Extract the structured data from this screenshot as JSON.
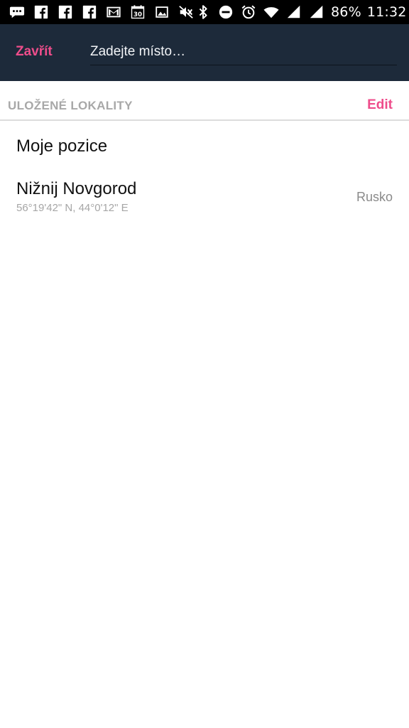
{
  "status_bar": {
    "battery_percent": "86%",
    "time": "11:32",
    "notification_icons": [
      "chat-icon",
      "facebook-icon",
      "facebook-icon",
      "facebook-icon",
      "gmail-icon",
      "calendar-icon",
      "gallery-icon",
      "mute-icon"
    ],
    "system_icons": [
      "bluetooth-icon",
      "do-not-disturb-icon",
      "alarm-icon",
      "wifi-icon",
      "signal-icon",
      "signal-icon"
    ],
    "calendar_day": "30"
  },
  "header": {
    "close_label": "Zavřít",
    "search_placeholder": "Zadejte místo…",
    "search_value": "",
    "accent_color": "#ee4d8b",
    "background_color": "#1d2a3a"
  },
  "saved_locations": {
    "title": "ULOŽENÉ LOKALITY",
    "edit_label": "Edit",
    "current_location_label": "Moje pozice",
    "items": [
      {
        "name": "Nižnij Novgorod",
        "coordinates": "56°19'42\" N, 44°0'12\" E",
        "country": "Rusko"
      }
    ]
  }
}
